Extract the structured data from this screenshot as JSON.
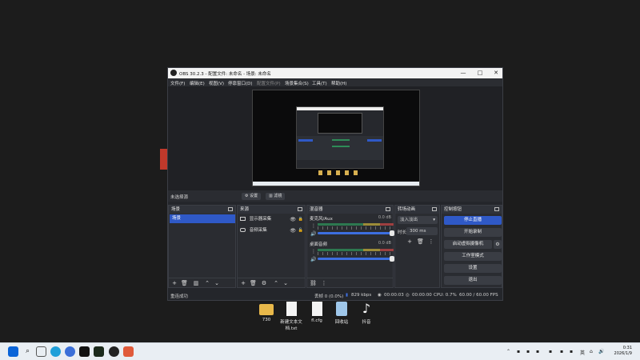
{
  "desktop": {
    "icons": [
      {
        "label": "730"
      },
      {
        "label": "新建文本文\n档.txt"
      },
      {
        "label": "fl.cfg"
      },
      {
        "label": "回收站"
      },
      {
        "label": "抖音"
      }
    ]
  },
  "taskbar": {
    "clock_time": "0:31",
    "clock_date": "2026/1/9",
    "tray_lang": "英"
  },
  "window": {
    "title": "OBS 30.2.3 - 配置文件: 未命名 - 场景: 未命名",
    "controls": {
      "minimize": "—",
      "maximize": "□",
      "close": "✕"
    }
  },
  "menu": [
    "文件(F)",
    "编辑(E)",
    "视图(V)",
    "停靠窗口(D)",
    "配置文件(P)",
    "场景集合(S)",
    "工具(T)",
    "帮助(H)"
  ],
  "toolbar_row": {
    "no_source": "未选择源",
    "properties": "设置",
    "filters": "滤镜"
  },
  "docks": {
    "scenes": {
      "title": "场景",
      "items": [
        "场景"
      ]
    },
    "sources": {
      "title": "来源",
      "items": [
        "显示器采集",
        "音频采集"
      ]
    },
    "mixer": {
      "title": "混音器",
      "channels": [
        {
          "name": "麦克风/Aux",
          "db": "0.0 dB"
        },
        {
          "name": "桌面音频",
          "db": "0.0 dB"
        }
      ]
    },
    "transitions": {
      "title": "转场动画",
      "selected": "淡入淡出",
      "duration_label": "时长",
      "duration_value": "300 ms"
    },
    "controls": {
      "title": "控制按钮",
      "buttons": [
        "停止直播",
        "开始录制",
        "启动虚拟摄像机",
        "工作室模式",
        "设置",
        "退出"
      ]
    }
  },
  "status": {
    "left": "重连成功",
    "dropped": "丢帧 0 (0.0%)",
    "bitrate": "829 kbps",
    "live_time": "00:00:03",
    "rec_time": "00:00:00",
    "cpu": "CPU: 0.7%",
    "fps": "60.00 / 60.00 FPS"
  },
  "colors": {
    "accent": "#2f59c7",
    "panel": "#2a2c31",
    "window_bg": "#24262b"
  }
}
